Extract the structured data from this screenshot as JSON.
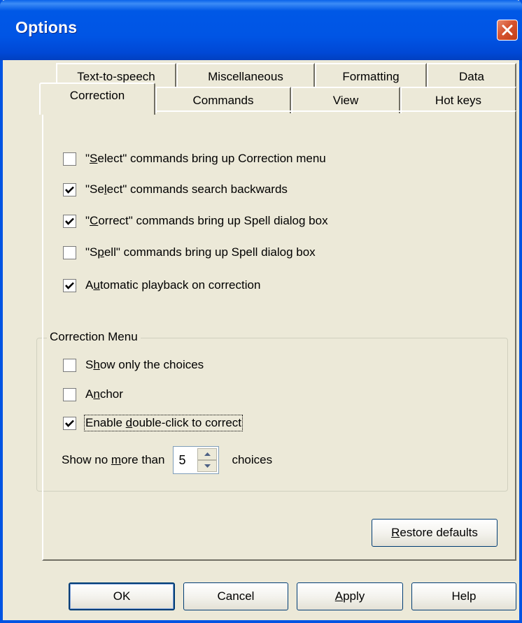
{
  "window": {
    "title": "Options"
  },
  "tabs": {
    "row1": [
      "Text-to-speech",
      "Miscellaneous",
      "Formatting",
      "Data"
    ],
    "row2": [
      "Correction",
      "Commands",
      "View",
      "Hot keys"
    ],
    "active": "Correction"
  },
  "correction": {
    "options": [
      {
        "prefix": "\"",
        "mnemonic": "S",
        "rest": "elect\" commands bring up Correction menu",
        "checked": false
      },
      {
        "prefix": "\"Se",
        "mnemonic": "l",
        "rest": "ect\" commands search backwards",
        "checked": true
      },
      {
        "prefix": "\"",
        "mnemonic": "C",
        "rest": "orrect\" commands bring up Spell dialog box",
        "checked": true
      },
      {
        "prefix": "\"S",
        "mnemonic": "p",
        "rest": "ell\" commands bring up Spell dialog box",
        "checked": false
      },
      {
        "prefix": "A",
        "mnemonic": "u",
        "rest": "tomatic playback on correction",
        "checked": true
      }
    ],
    "menu_group": {
      "title": "Correction Menu",
      "options": [
        {
          "prefix": "S",
          "mnemonic": "h",
          "rest": "ow only the choices",
          "checked": false
        },
        {
          "prefix": "A",
          "mnemonic": "n",
          "rest": "chor",
          "checked": false
        },
        {
          "prefix": "Enable ",
          "mnemonic": "d",
          "rest": "ouble-click to correct",
          "checked": true
        }
      ],
      "show_prefix": "Show no ",
      "show_mnemonic": "m",
      "show_rest": "ore than",
      "choices_value": "5",
      "choices_suffix": "choices"
    },
    "restore": {
      "mnemonic": "R",
      "rest": "estore defaults"
    }
  },
  "buttons": {
    "ok": "OK",
    "cancel": "Cancel",
    "apply_mnemonic": "A",
    "apply_rest": "pply",
    "help": "Help"
  }
}
